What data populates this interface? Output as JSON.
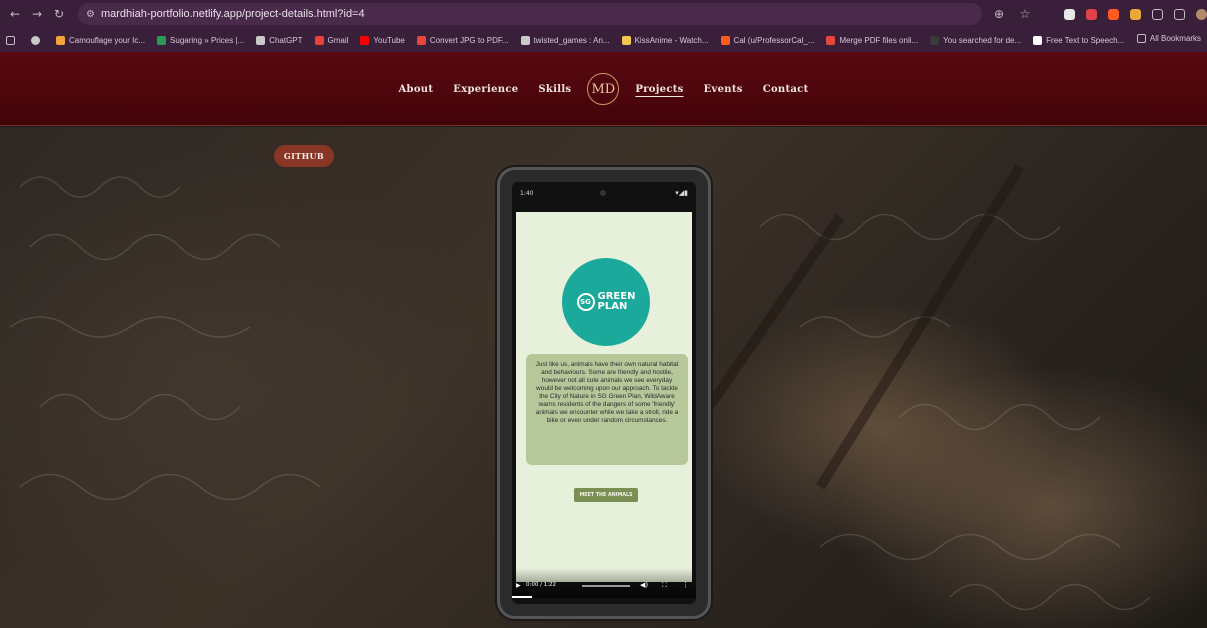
{
  "browser": {
    "url": "mardhiah-portfolio.netlify.app/project-details.html?id=4",
    "bookmarks": [
      {
        "label": "Camouflage your Ic...",
        "color": "#f2a33a"
      },
      {
        "label": "Sugaring » Prices |...",
        "color": "#2a9a5a"
      },
      {
        "label": "ChatGPT",
        "color": "#c9c9c9"
      },
      {
        "label": "Gmail",
        "color": "#e94235"
      },
      {
        "label": "YouTube",
        "color": "#ff0000"
      },
      {
        "label": "Convert JPG to PDF...",
        "color": "#e8453c"
      },
      {
        "label": "twisted_games : An...",
        "color": "#c9c9c9"
      },
      {
        "label": "KissAnime - Watch...",
        "color": "#f2c84b"
      },
      {
        "label": "Cal (u/ProfessorCal_...",
        "color": "#ff5a1f"
      },
      {
        "label": "Merge PDF files onli...",
        "color": "#e8453c"
      },
      {
        "label": "You searched for de...",
        "color": "#3a3a3a"
      },
      {
        "label": "Free Text to Speech...",
        "color": "#ffffff"
      }
    ],
    "all_bookmarks": "All Bookmarks"
  },
  "header": {
    "nav": [
      "About",
      "Experience",
      "Skills"
    ],
    "nav_right": [
      "Projects",
      "Events",
      "Contact"
    ],
    "logo": "MD",
    "active": "Projects"
  },
  "project": {
    "github_label": "GITHUB",
    "phone_time": "1:40",
    "badge_sg": "SG",
    "badge_line1": "GREEN",
    "badge_line2": "PLAN",
    "description": "Just like us, animals have their own natural habitat and behaviours. Some are friendly and hostile, however not all cute animals we see everyday would be welcoming upon our approach. To tackle the City of Nature in SG Green Plan, WildAware warns residents of the dangers of some 'friendly' animals we encounter while we take a stroll, ride a bike or even under random circumstances.",
    "meet_button": "MEET THE ANIMALS",
    "video_time": "0:00 / 1:22"
  },
  "colors": {
    "header_bg": "#4a060c",
    "github_btn": "#8a3626",
    "badge": "#1aa99a",
    "desc_box": "#b6c89a"
  }
}
